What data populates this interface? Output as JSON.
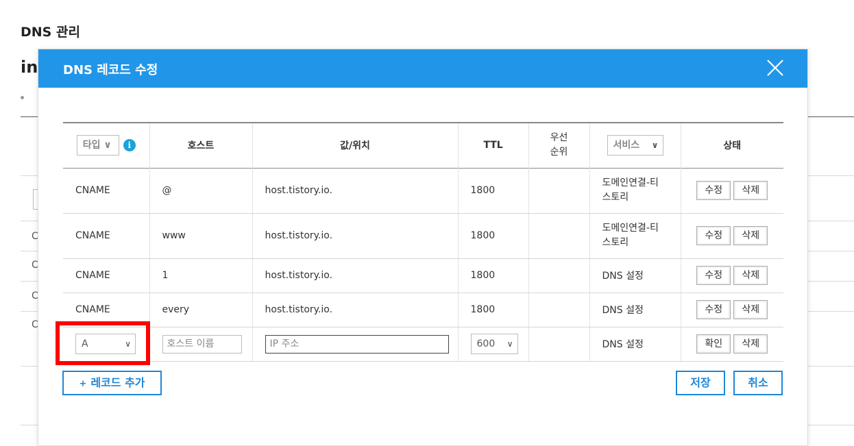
{
  "background": {
    "page_title": "DNS 관리",
    "domain_fragment": "int",
    "tab_fragment": "ㄹ",
    "row_fragments": [
      "C",
      "C",
      "C",
      "C"
    ]
  },
  "modal": {
    "title": "DNS 레코드 수정",
    "close_icon": "close-x-icon",
    "header_color": "#2196e8",
    "columns": {
      "type_select": "타입 ∨",
      "host": "호스트",
      "value": "값/위치",
      "ttl": "TTL",
      "priority": "우선\n순위",
      "service_select": "서비스",
      "status": "상태"
    },
    "rows": [
      {
        "type": "CNAME",
        "host": "@",
        "value": "host.tistory.io.",
        "ttl": "1800",
        "priority": "",
        "service": "도메인연결-티스토리",
        "service_line1": "도메인연결-티",
        "service_line2": "스토리",
        "edit": "수정",
        "delete": "삭제"
      },
      {
        "type": "CNAME",
        "host": "www",
        "value": "host.tistory.io.",
        "ttl": "1800",
        "priority": "",
        "service": "도메인연결-티스토리",
        "service_line1": "도메인연결-티",
        "service_line2": "스토리",
        "edit": "수정",
        "delete": "삭제"
      },
      {
        "type": "CNAME",
        "host": "1",
        "value": "host.tistory.io.",
        "ttl": "1800",
        "priority": "",
        "service": "DNS 설정",
        "edit": "수정",
        "delete": "삭제"
      },
      {
        "type": "CNAME",
        "host": "every",
        "value": "host.tistory.io.",
        "ttl": "1800",
        "priority": "",
        "service": "DNS 설정",
        "edit": "수정",
        "delete": "삭제"
      }
    ],
    "new_row": {
      "type_value": "A",
      "host_placeholder": "호스트 이름",
      "value_placeholder": "IP 주소",
      "ttl_value": "600",
      "service": "DNS 설정",
      "confirm": "확인",
      "delete": "삭제"
    },
    "add_record": "레코드 추가",
    "save": "저장",
    "cancel": "취소",
    "accent_color": "#1e86d8",
    "highlight_color": "#ff0000"
  }
}
